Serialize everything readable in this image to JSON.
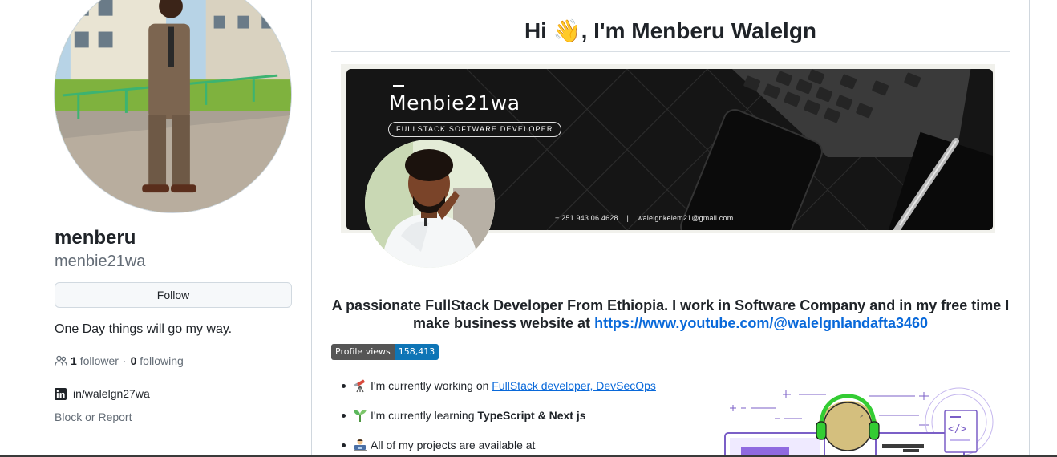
{
  "profile": {
    "display_name": "menberu",
    "username": "menbie21wa",
    "follow_label": "Follow",
    "bio": "One Day things will go my way.",
    "followers_count": "1",
    "followers_label": "follower",
    "following_count": "0",
    "following_label": "following",
    "social_link": "in/walelgn27wa",
    "block_report_label": "Block or Report"
  },
  "readme": {
    "greeting": "Hi 👋, I'm Menberu Walelgn",
    "banner": {
      "brand": "Menbie21wa",
      "tagline": "FULLSTACK SOFTWARE DEVELOPER",
      "phone": "+ 251 943 06 4628",
      "separator": "|",
      "email": "walelgnkelem21@gmail.com"
    },
    "intro_text": "A passionate FullStack Developer From Ethiopia. I work in Software Company and in my free time I make business website at",
    "intro_link": "https://www.youtube.com/@walelgnlandafta3460",
    "badge": {
      "label": "Profile views",
      "value": "158,413"
    },
    "list": [
      {
        "emoji": "telescope-icon",
        "text": "I'm currently working on ",
        "link": "FullStack developer, DevSecOps"
      },
      {
        "emoji": "seedling-icon",
        "text": "I'm currently learning ",
        "bold": "TypeScript & Next js"
      },
      {
        "emoji": "technologist-icon",
        "text": "All of my projects are available at"
      }
    ]
  },
  "colors": {
    "link": "#0969da",
    "badge_label_bg": "#555555",
    "badge_value_bg": "#0e75b6",
    "text_primary": "#1f2328",
    "text_muted": "#636c76"
  }
}
